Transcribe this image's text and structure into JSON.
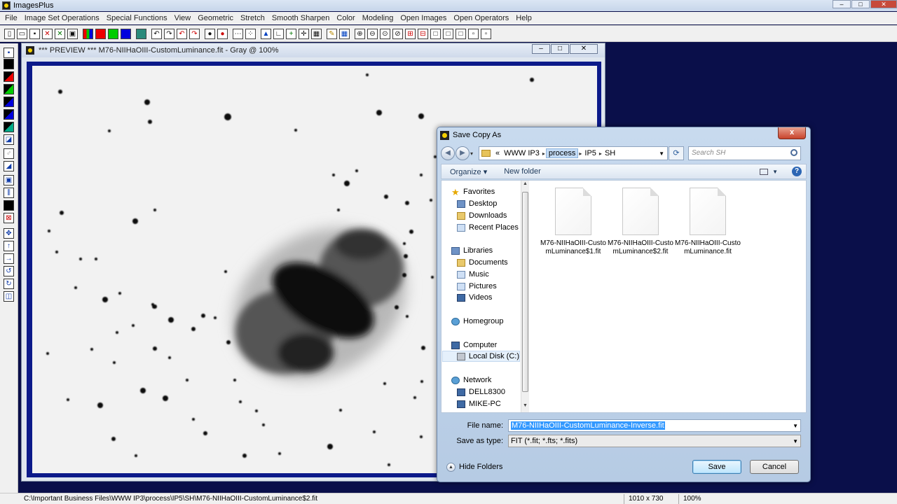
{
  "app": {
    "title": "ImagesPlus"
  },
  "menu": [
    "File",
    "Image Set Operations",
    "Special Functions",
    "View",
    "Geometric",
    "Stretch",
    "Smooth Sharpen",
    "Color",
    "Modeling",
    "Open Images",
    "Open Operators",
    "Help"
  ],
  "image_window": {
    "title": "*** PREVIEW *** M76-NIIHaOIII-CustomLuminance.fit - Gray @ 100%"
  },
  "dialog": {
    "title": "Save Copy As",
    "close_label": "x",
    "breadcrumb": {
      "prefix": "«",
      "items": [
        "WWW IP3",
        "process",
        "IP5",
        "SH"
      ]
    },
    "search_placeholder": "Search SH",
    "organize_label": "Organize ▾",
    "new_folder_label": "New folder",
    "help_label": "?",
    "nav": {
      "favorites": "Favorites",
      "desktop": "Desktop",
      "downloads": "Downloads",
      "recent_places": "Recent Places",
      "libraries": "Libraries",
      "documents": "Documents",
      "music": "Music",
      "pictures": "Pictures",
      "videos": "Videos",
      "homegroup": "Homegroup",
      "computer": "Computer",
      "local_disk": "Local Disk (C:)",
      "network": "Network",
      "dell8300": "DELL8300",
      "mike_pc": "MIKE-PC"
    },
    "files": [
      {
        "name": "M76-NIIHaOIII-CustomLuminance$1.fit"
      },
      {
        "name": "M76-NIIHaOIII-CustomLuminance$2.fit"
      },
      {
        "name": "M76-NIIHaOIII-CustomLuminance.fit"
      }
    ],
    "file_name_label": "File name:",
    "file_name_value": "M76-NIIHaOIII-CustomLuminance-Inverse.fit",
    "save_as_type_label": "Save as type:",
    "save_as_type_value": "FIT (*.fit; *.fts; *.fits)",
    "hide_folders_label": "Hide Folders",
    "save_label": "Save",
    "cancel_label": "Cancel"
  },
  "status": {
    "path": "C:\\Important Business Files\\WWW IP3\\process\\IP5\\SH\\M76-NIIHaOIII-CustomLuminance$2.fit",
    "dimensions": "1010 x 730",
    "zoom": "100%"
  },
  "colors": {
    "desktop_bg": "#0a0f4a",
    "image_frame": "#0c1a8a",
    "selection": "#3399ff"
  }
}
